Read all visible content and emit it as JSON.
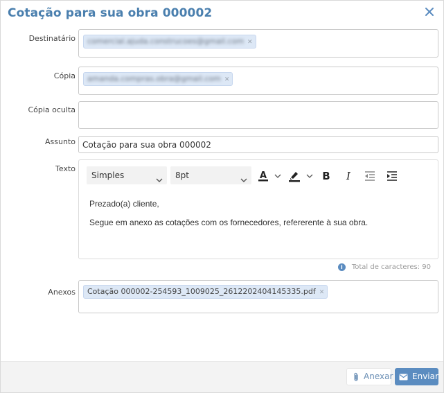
{
  "dialog": {
    "title": "Cotação para sua obra 000002",
    "close_icon": "close-icon"
  },
  "form": {
    "to_label": "Destinatário",
    "to_chip": "comercial.ajuda.construcoes@gmail.com",
    "cc_label": "Cópia",
    "cc_chip": "amanda.compras.obra@gmail.com",
    "bcc_label": "Cópia oculta",
    "subject_label": "Assunto",
    "subject_value": "Cotação para sua obra 000002",
    "text_label": "Texto",
    "attachments_label": "Anexos",
    "attachment_chip": "Cotação 000002-254593_1009025_2612202404145335.pdf"
  },
  "editor": {
    "font_family": "Simples",
    "font_size": "8pt",
    "tools": [
      "font-color-icon",
      "highlight-icon",
      "bold-icon",
      "italic-icon",
      "outdent-icon",
      "indent-icon"
    ],
    "bold_glyph": "B",
    "italic_glyph": "I",
    "font_color_glyph": "A",
    "line1": "Prezado(a) cliente,",
    "line2": "Segue em anexo as cotações com os fornecedores, refererente à sua obra.",
    "counter": "Total de caracteres: 90",
    "accent_color": "#5b8cc0"
  },
  "footer": {
    "attach_label": "Anexar",
    "send_label": "Enviar"
  }
}
